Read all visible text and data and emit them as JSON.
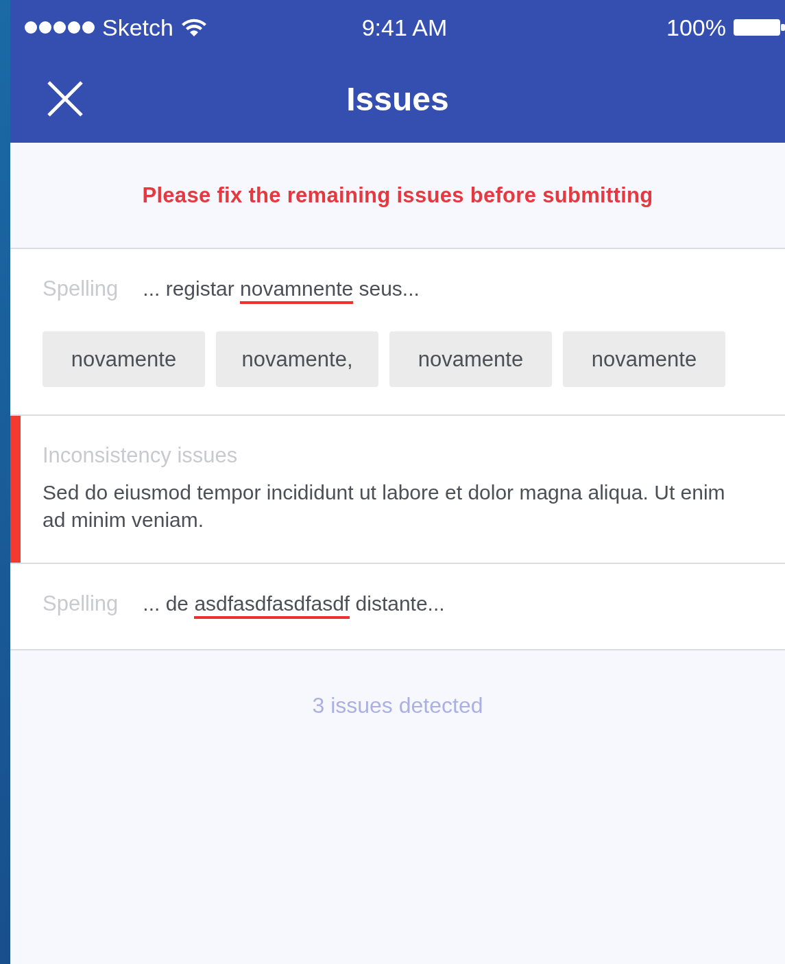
{
  "status_bar": {
    "carrier": "Sketch",
    "time": "9:41 AM",
    "battery": "100%"
  },
  "nav_bar": {
    "title": "Issues"
  },
  "banner": {
    "message": "Please fix the remaining issues before submitting"
  },
  "issues": [
    {
      "kind": "spelling",
      "selected": false,
      "label": "Spelling",
      "before": "... registar",
      "word": "novamnente",
      "after": "seus...",
      "suggestions": [
        "novamente",
        "novamente,",
        "novamente",
        "novamente"
      ]
    },
    {
      "kind": "inconsistency",
      "selected": true,
      "label": "Inconsistency issues",
      "text": "Sed do eiusmod tempor incididunt ut labore et dolor magna aliqua. Ut enim ad minim veniam."
    },
    {
      "kind": "spelling",
      "selected": false,
      "label": "Spelling",
      "before": "... de",
      "word": "asdfasdfasdfasdf",
      "after": "distante..."
    }
  ],
  "footer": {
    "summary": "3 issues detected"
  }
}
